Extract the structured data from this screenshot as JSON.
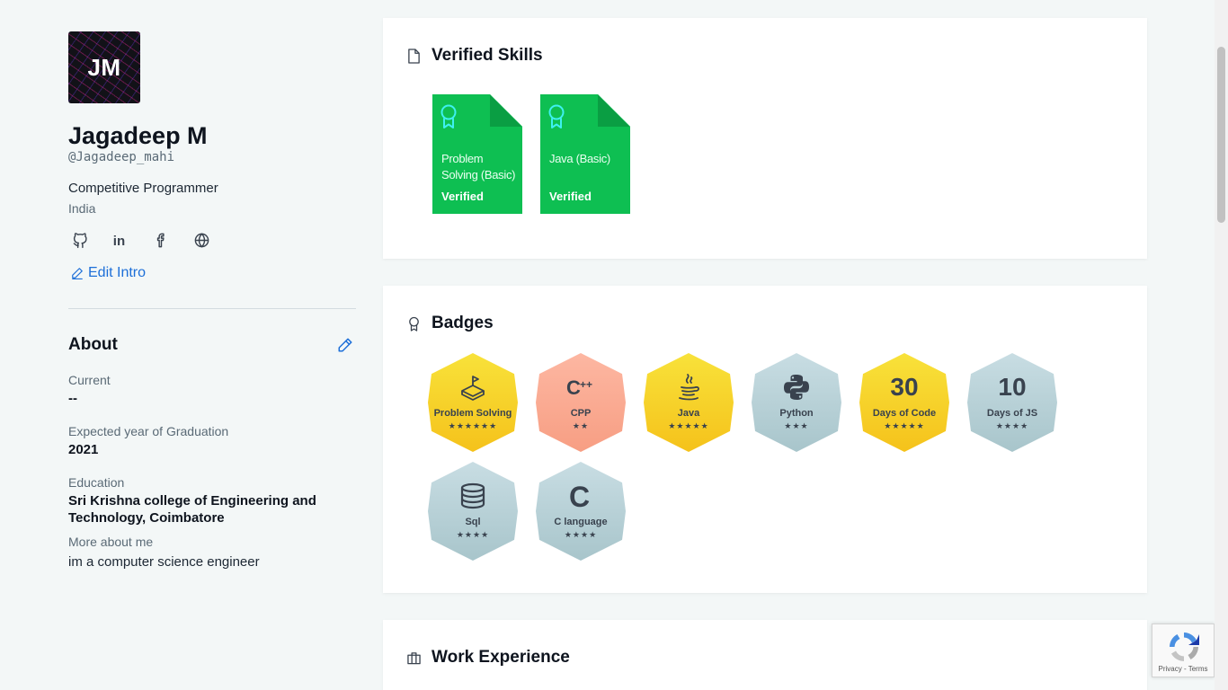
{
  "profile": {
    "avatar_initials": "JM",
    "name": "Jagadeep M",
    "handle": "@Jagadeep_mahi",
    "headline": "Competitive Programmer",
    "country": "India",
    "socials": [
      "github-icon",
      "linkedin-icon",
      "facebook-icon",
      "globe-icon"
    ],
    "edit_intro_label": "Edit Intro"
  },
  "about": {
    "title": "About",
    "fields": [
      {
        "label": "Current",
        "value": "--"
      },
      {
        "label": "Expected year of Graduation",
        "value": "2021"
      },
      {
        "label": "Education",
        "value": "Sri Krishna college of Engineering and Technology, Coimbatore"
      },
      {
        "label": "More about me",
        "value": "im a computer science engineer"
      }
    ]
  },
  "skills": {
    "title": "Verified Skills",
    "items": [
      {
        "name": "Problem Solving (Basic)",
        "status": "Verified"
      },
      {
        "name": "Java (Basic)",
        "status": "Verified"
      }
    ]
  },
  "badges": {
    "title": "Badges",
    "items": [
      {
        "name": "Problem Solving",
        "stars": "★★★★★★",
        "stars_count": 6,
        "style": "gold",
        "icon": "problem-solving-icon",
        "color": "#f5c21b"
      },
      {
        "name": "CPP",
        "stars": "★★",
        "stars_count": 2,
        "style": "salmon",
        "icon": "cpp-icon",
        "color": "#f79e83"
      },
      {
        "name": "Java",
        "stars": "★★★★★",
        "stars_count": 5,
        "style": "gold",
        "icon": "java-icon",
        "color": "#f5c21b"
      },
      {
        "name": "Python",
        "stars": "★★★",
        "stars_count": 3,
        "style": "steel",
        "icon": "python-icon",
        "color": "#a8c5cb"
      },
      {
        "name": "Days of Code",
        "number": "30",
        "stars": "★★★★★",
        "stars_count": 5,
        "style": "gold",
        "icon": "",
        "color": "#f5c21b"
      },
      {
        "name": "Days of JS",
        "number": "10",
        "stars": "★★★★",
        "stars_count": 4,
        "style": "steel",
        "icon": "",
        "color": "#a8c5cb"
      },
      {
        "name": "Sql",
        "stars": "★★★★",
        "stars_count": 4,
        "style": "steel",
        "icon": "database-icon",
        "color": "#a8c5cb"
      },
      {
        "name": "C language",
        "stars": "★★★★",
        "stars_count": 4,
        "style": "steel",
        "icon": "c-language-icon",
        "color": "#a8c5cb"
      }
    ]
  },
  "work": {
    "title": "Work Experience"
  },
  "recaptcha": {
    "links": "Privacy - Terms"
  },
  "colors": {
    "accent": "#1d6fd8",
    "verified_green": "#0ebf52",
    "background": "#f3f7f7"
  }
}
